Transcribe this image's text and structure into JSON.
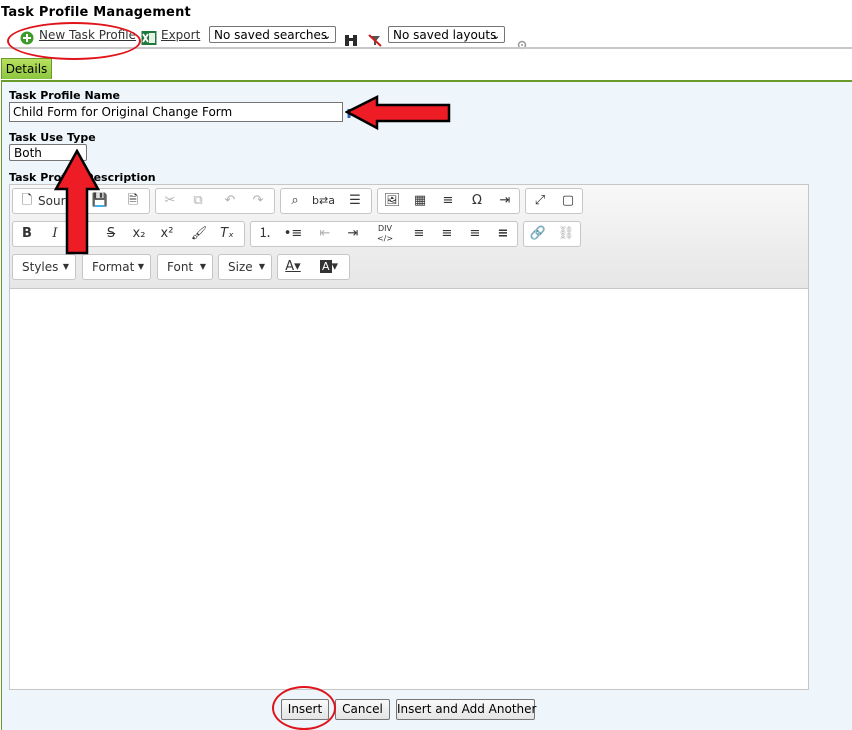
{
  "page": {
    "title": "Task Profile Management"
  },
  "toolbar": {
    "new_task_profile": "New Task Profile",
    "export": "Export",
    "saved_searches": "No saved searches",
    "saved_layouts": "No saved layouts"
  },
  "tabs": [
    {
      "label": "Details"
    }
  ],
  "form": {
    "name_label": "Task Profile Name",
    "name_value": "Child Form for Original Change Form",
    "use_type_label": "Task Use Type",
    "use_type_value": "Both",
    "description_label": "Task Profile Description"
  },
  "editor": {
    "source_label": "Source",
    "styles_label": "Styles",
    "format_label": "Format",
    "font_label": "Font",
    "size_label": "Size"
  },
  "buttons": {
    "insert": "Insert",
    "cancel": "Cancel",
    "insert_add_another": "Insert and Add Another"
  },
  "colors": {
    "accent_green": "#8cc63f",
    "panel_background": "#eef6fb",
    "annotation_red": "#e0141b"
  }
}
